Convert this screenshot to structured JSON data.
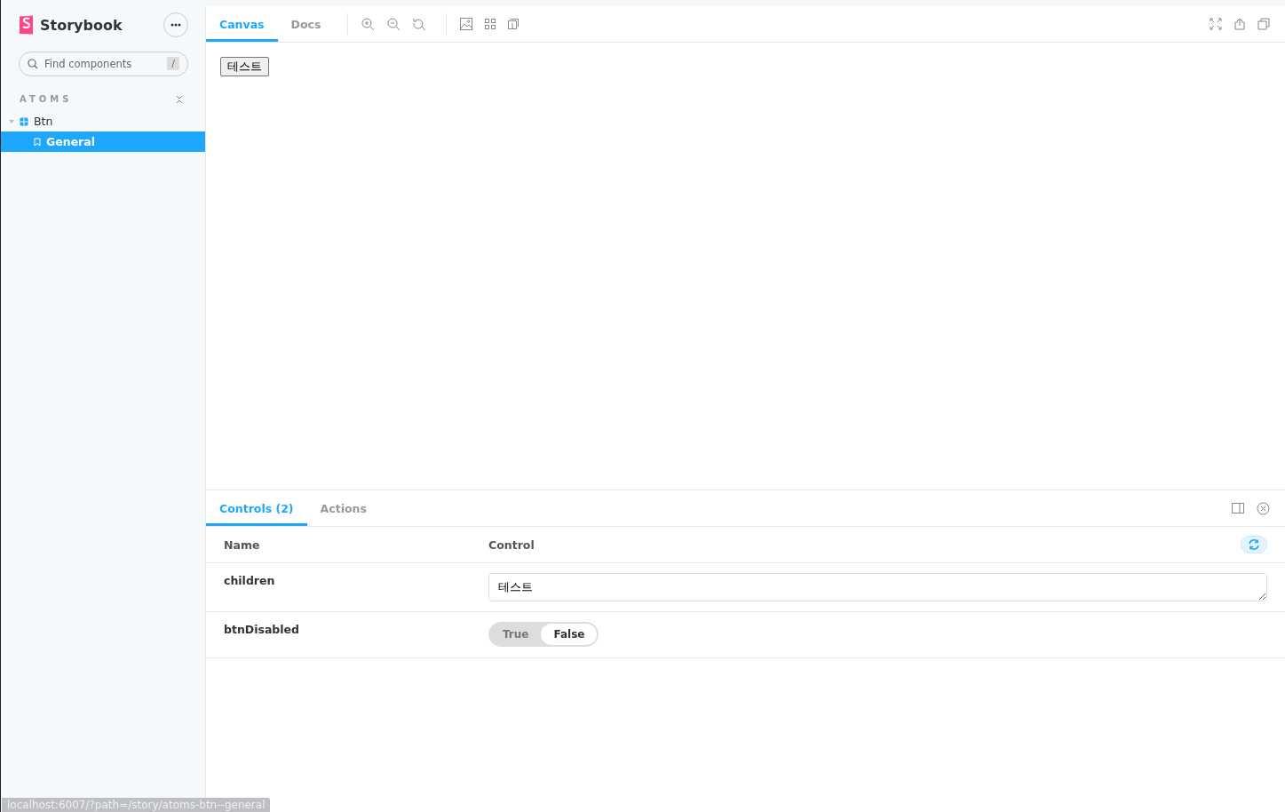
{
  "sidebar": {
    "brand": "Storybook",
    "search": {
      "placeholder": "Find components",
      "shortcut": "/"
    },
    "group": {
      "label": "ATOMS",
      "expanded": true
    },
    "tree": [
      {
        "label": "Btn",
        "expanded": true,
        "selected": false,
        "children": [
          {
            "label": "General",
            "selected": true
          }
        ]
      }
    ]
  },
  "toolbar": {
    "tabs": [
      {
        "label": "Canvas",
        "selected": true
      },
      {
        "label": "Docs",
        "selected": false
      }
    ]
  },
  "preview": {
    "button": "테스트"
  },
  "addons": {
    "tabs": [
      {
        "label": "Controls (2)",
        "selected": true
      },
      {
        "label": "Actions",
        "selected": false
      }
    ],
    "columns": [
      "Name",
      "Control"
    ],
    "rows": [
      {
        "name": "children",
        "kind": "text",
        "value": "테스트"
      },
      {
        "name": "btnDisabled",
        "kind": "boolean",
        "options": [
          {
            "label": "True",
            "selected": false
          },
          {
            "label": "False",
            "selected": true
          }
        ]
      }
    ]
  },
  "status_url": "localhost:6007/?path=/story/atoms-btn--general"
}
